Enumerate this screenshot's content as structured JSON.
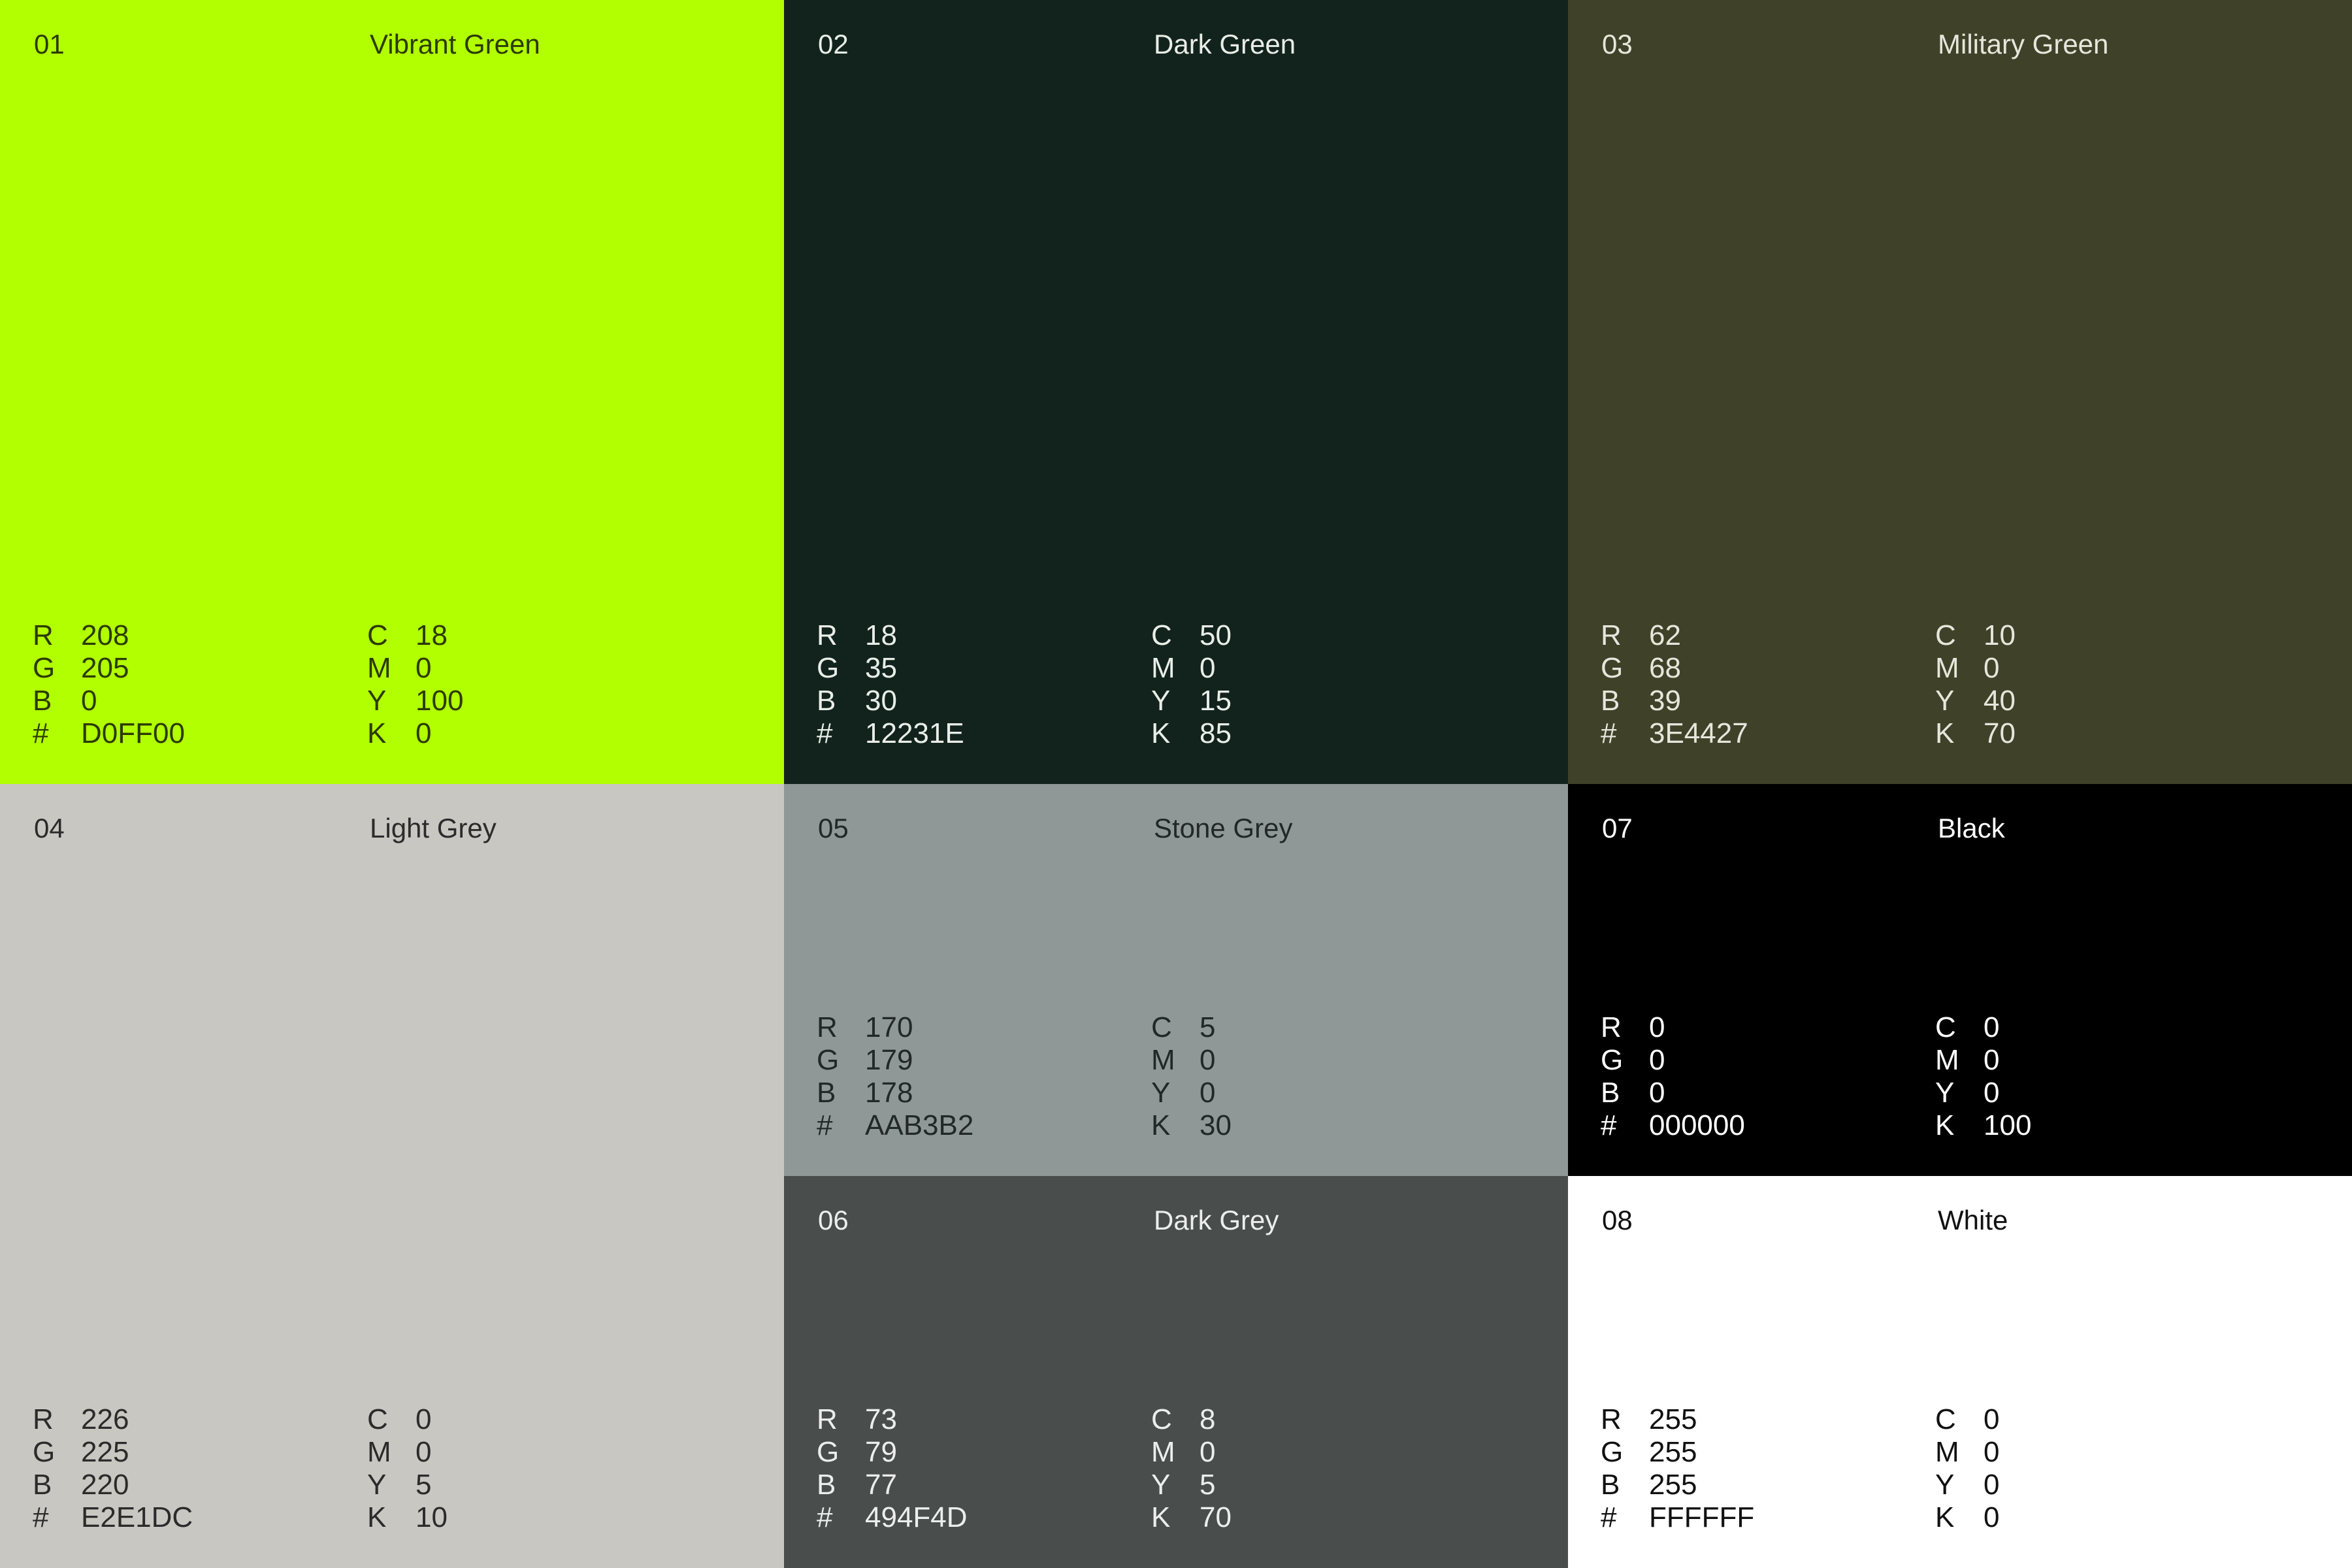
{
  "swatches": [
    {
      "number": "01",
      "name": "Vibrant Green",
      "color": "#B1FF00",
      "rgb": {
        "R": "208",
        "G": "205",
        "B": "0",
        "hex": "D0FF00"
      },
      "cmyk": {
        "C": "18",
        "M": "0",
        "Y": "100",
        "K": "0"
      }
    },
    {
      "number": "02",
      "name": "Dark Green",
      "color": "#12231E",
      "rgb": {
        "R": "18",
        "G": "35",
        "B": "30",
        "hex": "12231E"
      },
      "cmyk": {
        "C": "50",
        "M": "0",
        "Y": "15",
        "K": "85"
      }
    },
    {
      "number": "03",
      "name": "Military Green",
      "color": "#3F4229",
      "rgb": {
        "R": "62",
        "G": "68",
        "B": "39",
        "hex": "3E4427"
      },
      "cmyk": {
        "C": "10",
        "M": "0",
        "Y": "40",
        "K": "70"
      }
    },
    {
      "number": "04",
      "name": "Light Grey",
      "color": "#C8C7C2",
      "rgb": {
        "R": "226",
        "G": "225",
        "B": "220",
        "hex": "E2E1DC"
      },
      "cmyk": {
        "C": "0",
        "M": "0",
        "Y": "5",
        "K": "10"
      }
    },
    {
      "number": "05",
      "name": "Stone Grey",
      "color": "#909897",
      "rgb": {
        "R": "170",
        "G": "179",
        "B": "178",
        "hex": "AAB3B2"
      },
      "cmyk": {
        "C": "5",
        "M": "0",
        "Y": "0",
        "K": "30"
      }
    },
    {
      "number": "06",
      "name": "Dark Grey",
      "color": "#494E4D",
      "rgb": {
        "R": "73",
        "G": "79",
        "B": "77",
        "hex": "494F4D"
      },
      "cmyk": {
        "C": "8",
        "M": "0",
        "Y": "5",
        "K": "70"
      }
    },
    {
      "number": "07",
      "name": "Black",
      "color": "#000000",
      "rgb": {
        "R": "0",
        "G": "0",
        "B": "0",
        "hex": "000000"
      },
      "cmyk": {
        "C": "0",
        "M": "0",
        "Y": "0",
        "K": "100"
      }
    },
    {
      "number": "08",
      "name": "White",
      "color": "#FFFFFF",
      "rgb": {
        "R": "255",
        "G": "255",
        "B": "255",
        "hex": "FFFFFF"
      },
      "cmyk": {
        "C": "0",
        "M": "0",
        "Y": "0",
        "K": "0"
      }
    }
  ],
  "labels": {
    "R": "R",
    "G": "G",
    "B": "B",
    "hex": "#",
    "C": "C",
    "M": "M",
    "Y": "Y",
    "K": "K"
  }
}
